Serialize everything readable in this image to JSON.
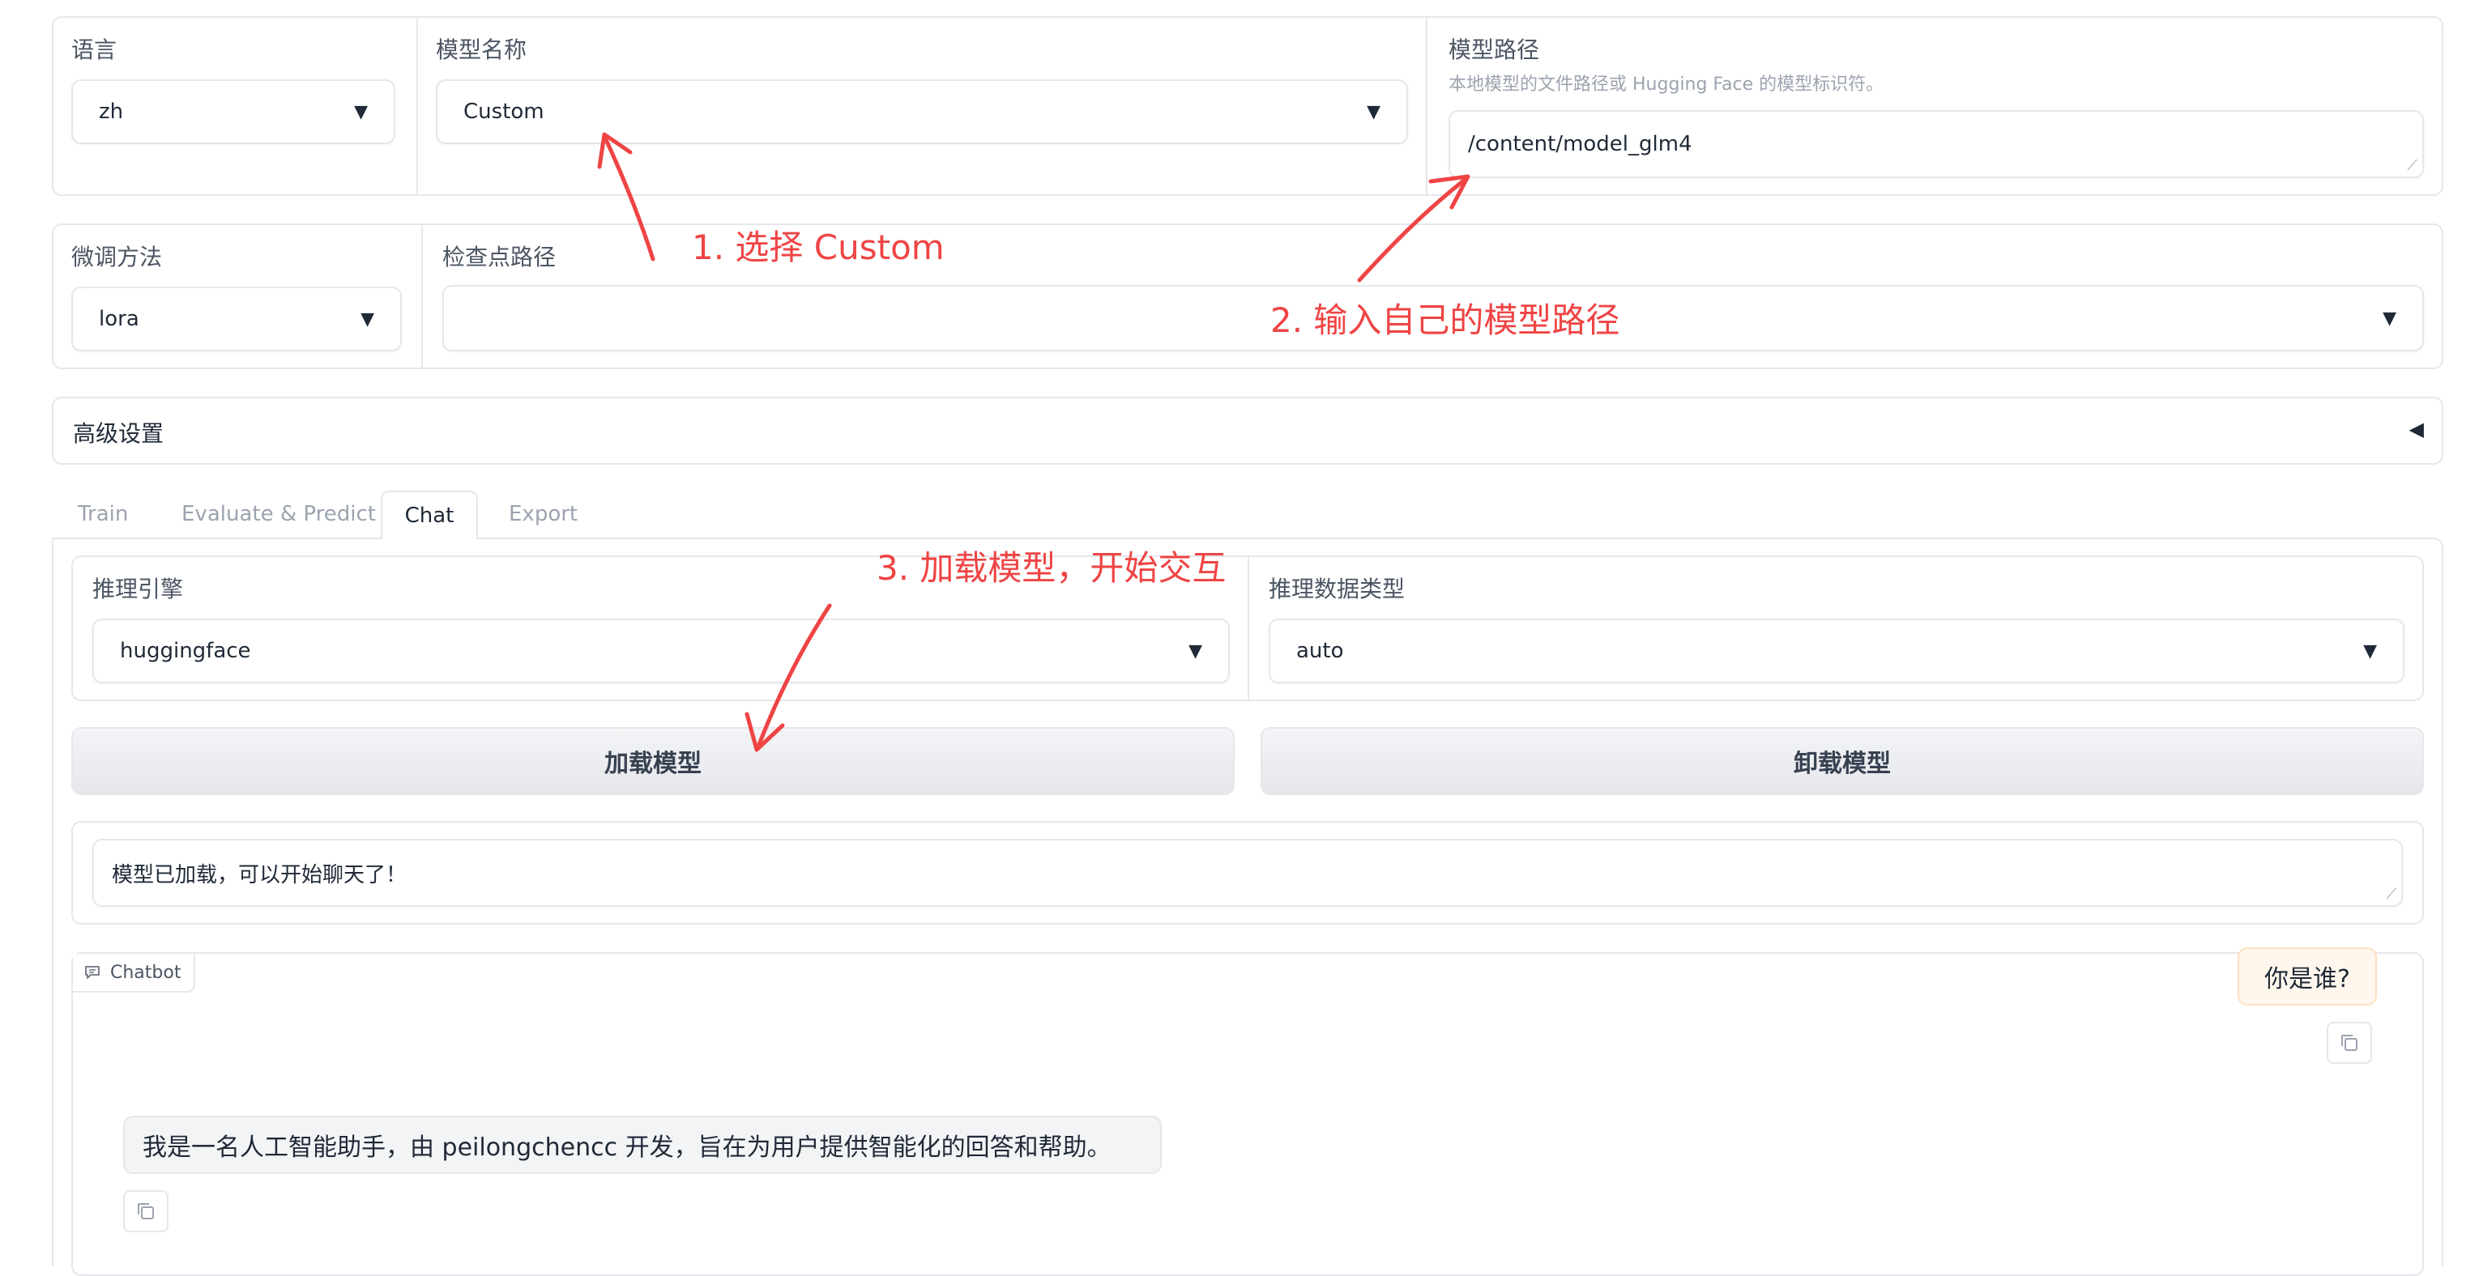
{
  "top": {
    "language": {
      "label": "语言",
      "value": "zh"
    },
    "model_name": {
      "label": "模型名称",
      "value": "Custom"
    },
    "model_path": {
      "label": "模型路径",
      "hint": "本地模型的文件路径或 Hugging Face 的模型标识符。",
      "value": "/content/model_glm4"
    }
  },
  "finetune": {
    "method": {
      "label": "微调方法",
      "value": "lora"
    },
    "checkpoint": {
      "label": "检查点路径",
      "value": ""
    }
  },
  "advanced": {
    "label": "高级设置",
    "toggle_icon": "◀"
  },
  "tabs": [
    {
      "label": "Train"
    },
    {
      "label": "Evaluate & Predict"
    },
    {
      "label": "Chat"
    },
    {
      "label": "Export"
    }
  ],
  "active_tab": "Chat",
  "chat": {
    "engine": {
      "label": "推理引擎",
      "value": "huggingface"
    },
    "dtype": {
      "label": "推理数据类型",
      "value": "auto"
    },
    "load_button": "加载模型",
    "unload_button": "卸载模型",
    "status_text": "模型已加载，可以开始聊天了！",
    "chatbot_label": "Chatbot",
    "messages": [
      {
        "role": "user",
        "text": "你是谁?"
      },
      {
        "role": "assistant",
        "text": "我是一名人工智能助手，由 peilongchencc 开发，旨在为用户提供智能化的回答和帮助。"
      }
    ]
  },
  "annotations": [
    "1. 选择 Custom",
    "2. 输入自己的模型路径",
    "3. 加载模型，开始交互"
  ],
  "colors": {
    "annotation": "#ef4444",
    "border": "#e5e7eb",
    "user_bubble": "#fff7ed",
    "bot_bubble": "#f3f4f6"
  }
}
